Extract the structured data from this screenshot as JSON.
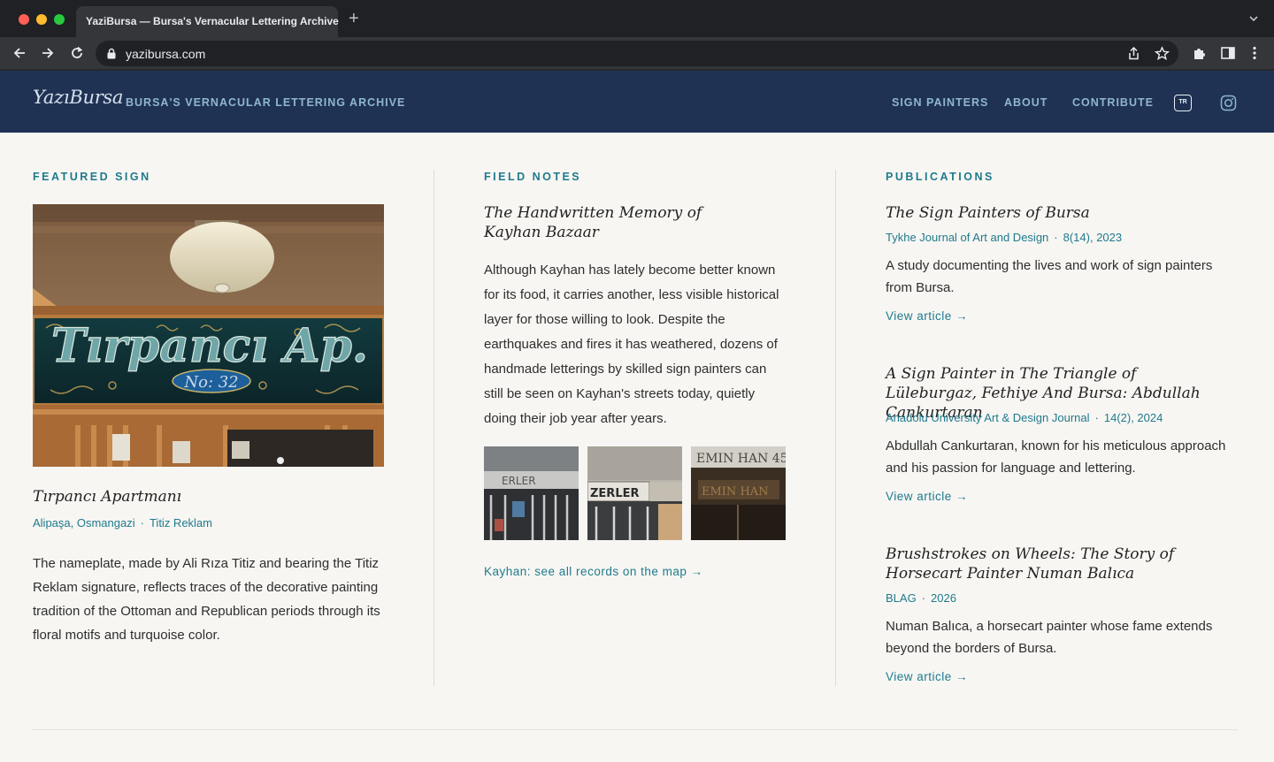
{
  "browser": {
    "tab_title": "YaziBursa — Bursa's Vernacular Lettering Archive",
    "url": "yazibursa.com"
  },
  "header": {
    "logo": "YazıBursa",
    "tagline": "BURSA'S VERNACULAR LETTERING ARCHIVE",
    "nav": [
      "SIGN PAINTERS",
      "ABOUT",
      "CONTRIBUTE"
    ],
    "lang_badge": "TR"
  },
  "featured": {
    "label": "FEATURED SIGN",
    "title": "Tırpancı Apartmanı",
    "location": "Alipaşa, Osmangazi",
    "maker": "Titiz Reklam",
    "description": "The nameplate, made by Ali Rıza Titiz and bearing the Titiz Reklam signature, reflects traces of the decorative painting tradition of the Ottoman and Republican periods through its floral motifs and turquoise color.",
    "sign_text": "Tırpancı Ap.",
    "sign_number": "No: 32"
  },
  "field_notes": {
    "label": "FIELD NOTES",
    "title": "The Handwritten Memory of Kayhan Bazaar",
    "body": "Although Kayhan has lately become better known for its food, it carries another, less visible historical layer for those willing to look. Despite the earthquakes and fires it has weathered, dozens of handmade letterings by skilled sign painters can still be seen on Kayhan's streets today, quietly doing their job year after years.",
    "thumb_texts": [
      "ERLER",
      "ZERLER",
      "EMIN HAN 45"
    ],
    "map_link": "Kayhan: see all records on the map →"
  },
  "publications": {
    "label": "PUBLICATIONS",
    "items": [
      {
        "title": "The Sign Painters of Bursa",
        "journal": "Tykhe Journal of Art and Design",
        "issue": "8(14), 2023",
        "summary": "A study documenting the lives and work of sign painters from Bursa.",
        "link": "View article →"
      },
      {
        "title": "A Sign Painter in The Triangle of Lüleburgaz, Fethiye And Bursa: Abdullah Cankurtaran",
        "journal": "Anadolu University Art & Design Journal",
        "issue": "14(2), 2024",
        "summary": "Abdullah Cankurtaran, known for his meticulous approach and his passion for language and lettering.",
        "link": "View article →"
      },
      {
        "title": "Brushstrokes on Wheels: The Story of Horsecart Painter Numan Balıca",
        "journal": "BLAG",
        "issue": "2026",
        "summary": "Numan Balıca, a horsecart painter whose fame extends beyond the borders of Bursa.",
        "link": "View article →"
      }
    ]
  },
  "colors": {
    "header_bg": "#1f3253",
    "accent": "#1f7a8c",
    "page_bg": "#f7f6f3"
  }
}
